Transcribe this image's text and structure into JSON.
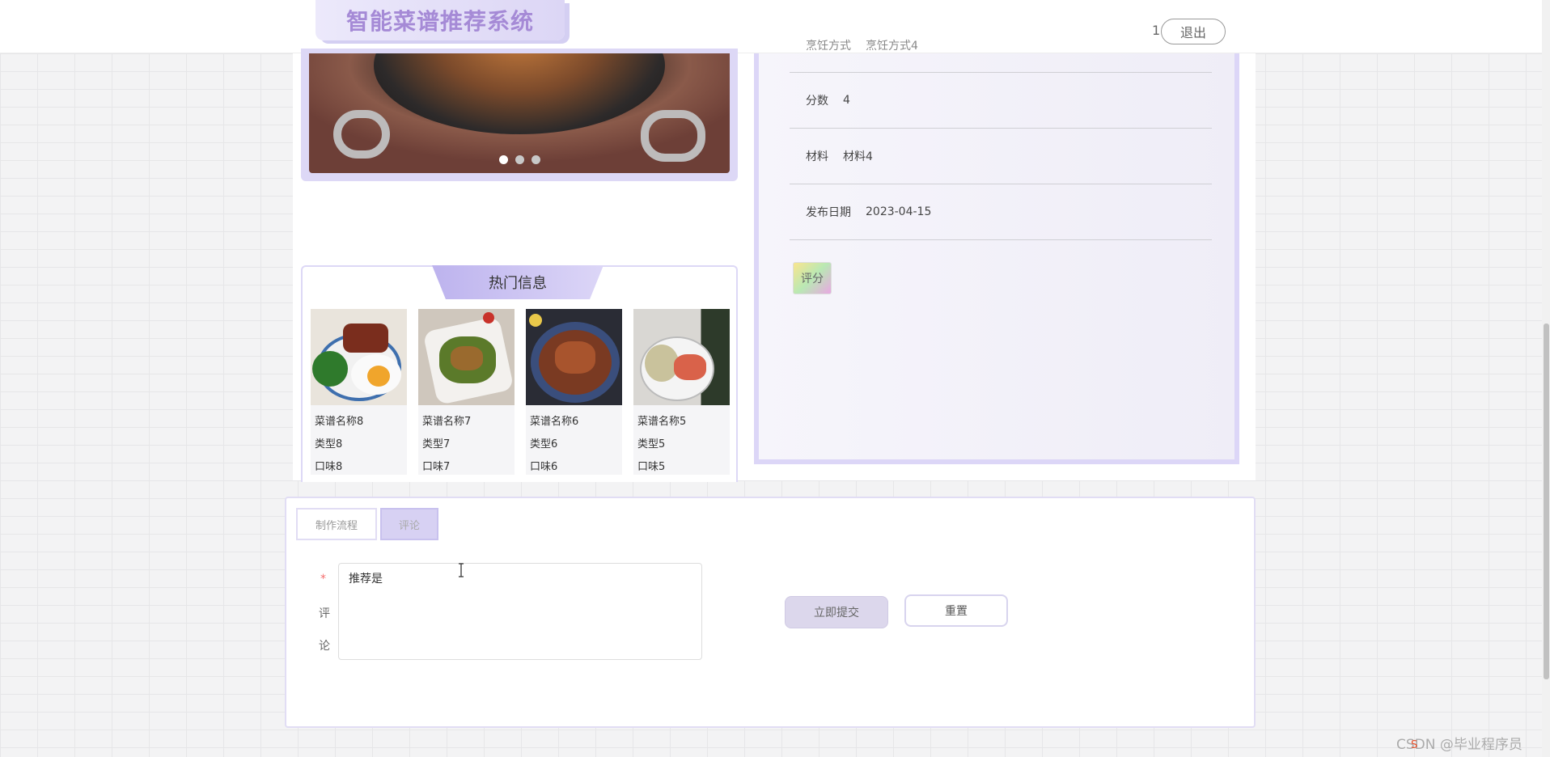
{
  "header": {
    "brand_title": "智能菜谱推荐系统",
    "user_number": "1",
    "logout_label": "退出"
  },
  "carousel": {
    "dots": 3,
    "active_index": 0
  },
  "detail": {
    "partial_row": {
      "label": "烹饪方式",
      "value": "烹饪方式4"
    },
    "rows": [
      {
        "label": "分数",
        "value": "4"
      },
      {
        "label": "材料",
        "value": "材料4"
      },
      {
        "label": "发布日期",
        "value": "2023-04-15"
      }
    ],
    "rate_label": "评分"
  },
  "hot": {
    "title": "热门信息",
    "items": [
      {
        "name": "菜谱名称8",
        "type": "类型8",
        "taste": "口味8"
      },
      {
        "name": "菜谱名称7",
        "type": "类型7",
        "taste": "口味7"
      },
      {
        "name": "菜谱名称6",
        "type": "类型6",
        "taste": "口味6"
      },
      {
        "name": "菜谱名称5",
        "type": "类型5",
        "taste": "口味5"
      }
    ]
  },
  "tabs": [
    {
      "label": "制作流程",
      "active": false
    },
    {
      "label": "评论",
      "active": true
    }
  ],
  "comment_form": {
    "required_mark": "*",
    "label_char_1": "评",
    "label_char_2": "论",
    "comment_value": "推荐是",
    "submit_label": "立即提交",
    "reset_label": "重置"
  },
  "footer": {
    "watermark": "CSDN @毕业程序员"
  },
  "colors": {
    "accent": "#dcd6f7",
    "brand_text": "#a58ad6",
    "required": "#f56c6c"
  }
}
